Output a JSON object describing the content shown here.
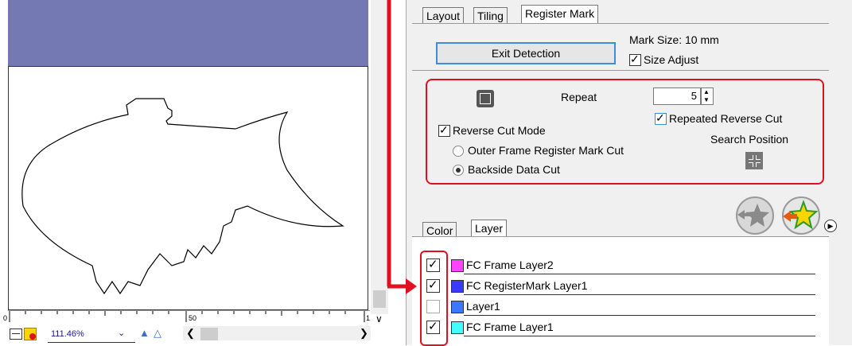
{
  "tabs_top": [
    {
      "label": "Layout"
    },
    {
      "label": "Tiling"
    },
    {
      "label": "Register Mark"
    }
  ],
  "register": {
    "exit_label": "Exit Detection",
    "mark_size": "Mark Size:  10 mm",
    "size_adjust": "Size Adjust",
    "size_adjust_checked": true,
    "repeat_label": "Repeat",
    "repeat_value": "5",
    "repeated_reverse_cut": "Repeated Reverse Cut",
    "repeated_reverse_cut_checked": true,
    "reverse_cut_mode": "Reverse Cut Mode",
    "reverse_cut_mode_checked": true,
    "outer_frame": "Outer Frame Register Mark Cut",
    "outer_frame_selected": false,
    "backside": "Backside Data Cut",
    "backside_selected": true,
    "search_position": "Search Position"
  },
  "tabs_bottom": [
    {
      "label": "Color"
    },
    {
      "label": "Layer"
    }
  ],
  "layers": [
    {
      "name": "FC Frame Layer2",
      "checked": true,
      "color": "#ff44ff"
    },
    {
      "name": "FC RegisterMark Layer1",
      "checked": true,
      "color": "#3a3aff"
    },
    {
      "name": "Layer1",
      "checked": false,
      "color": "#3a78ff"
    },
    {
      "name": "FC Frame Layer1",
      "checked": true,
      "color": "#44ffff"
    }
  ],
  "canvas": {
    "ruler_labels": [
      "0",
      "50",
      "1"
    ],
    "zoom": "111.46%"
  },
  "colors": {
    "header": "#7479b3",
    "highlight": "#e01020",
    "focus": "#3c8ce0"
  }
}
